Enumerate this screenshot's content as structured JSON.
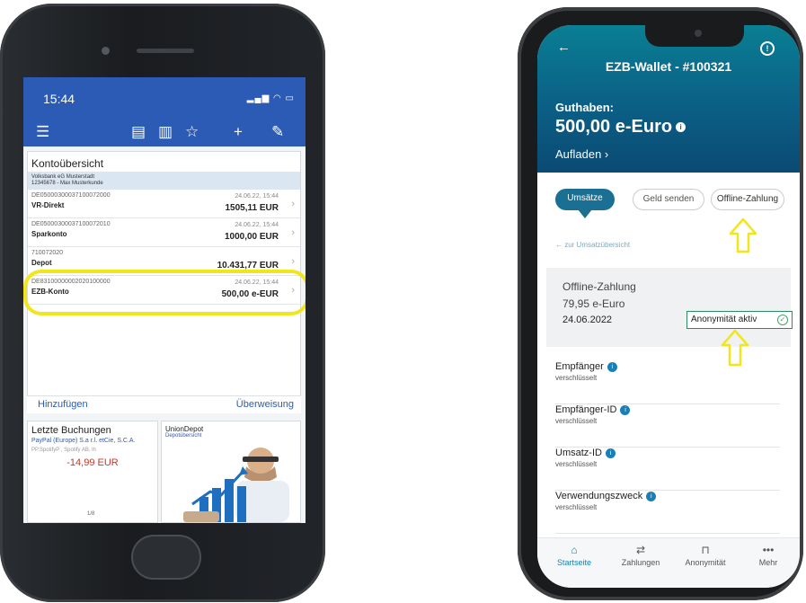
{
  "left_phone": {
    "status": {
      "time": "15:44",
      "signal": "▂▄▆ ◠ ▭"
    },
    "toolbar": {
      "menu_icon": "☰",
      "icon1": "▤",
      "icon2": "▥",
      "icon3": "☆",
      "add": "+",
      "edit": "✎"
    },
    "card_title": "Kontoübersicht",
    "bank_line1": "Volksbank eG Musterstadt",
    "bank_line2": "12345678 - Max Musterkunde",
    "accounts": [
      {
        "iban": "DE05000300037100072000",
        "name": "VR-Direkt",
        "date": "24.06.22, 15:44",
        "amount": "1505,11 EUR"
      },
      {
        "iban": "DE05000300037100072010",
        "name": "Sparkonto",
        "date": "24.06.22, 15:44",
        "amount": "1000,00 EUR"
      },
      {
        "iban": "710072020",
        "name": "Depot",
        "date": "",
        "amount": "10.431,77 EUR"
      },
      {
        "iban": "DE83100000002020100000",
        "name": "EZB-Konto",
        "date": "24.06.22, 15:44",
        "amount": "500,00  e-EUR"
      }
    ],
    "action_add": "Hinzufügen",
    "action_transfer": "Überweisung",
    "bookings_title": "Letzte Buchungen",
    "booking_payee": "PayPal (Europe) S.a r.l. etCie, S.C.A.",
    "booking_ref": "PP.SpotifyP , Spotify AB, lh",
    "booking_amount": "-14,99 EUR",
    "booking_page": "1/8",
    "depot_title": "UnionDepot",
    "depot_sub": "Depotübersicht"
  },
  "right_phone": {
    "back": "←",
    "title": "EZB-Wallet - #100321",
    "balance_label": "Guthaben:",
    "balance": "500,00 e-Euro",
    "balance_info": "i",
    "topup": "Aufladen  ›",
    "tabs": [
      "Umsätze",
      "Geld senden",
      "Offline-Zahlung"
    ],
    "back_link": "← zur Umsatzübersicht",
    "offline": {
      "type": "Offline-Zahlung",
      "amount": "79,95 e-Euro",
      "date": "24.06.2022",
      "anon": "Anonymität aktiv"
    },
    "fields": [
      {
        "label": "Empfänger",
        "value": "verschlüsselt"
      },
      {
        "label": "Empfänger-ID",
        "value": "verschlüsselt"
      },
      {
        "label": "Umsatz-ID",
        "value": "verschlüsselt"
      },
      {
        "label": "Verwendungszweck",
        "value": "verschlüsselt"
      }
    ],
    "nav": [
      "Startseite",
      "Zahlungen",
      "Anonymität",
      "Mehr"
    ],
    "colors": {
      "header": "#0b5f86",
      "highlight": "#f2e61b",
      "accent": "#1a7fb5"
    }
  }
}
